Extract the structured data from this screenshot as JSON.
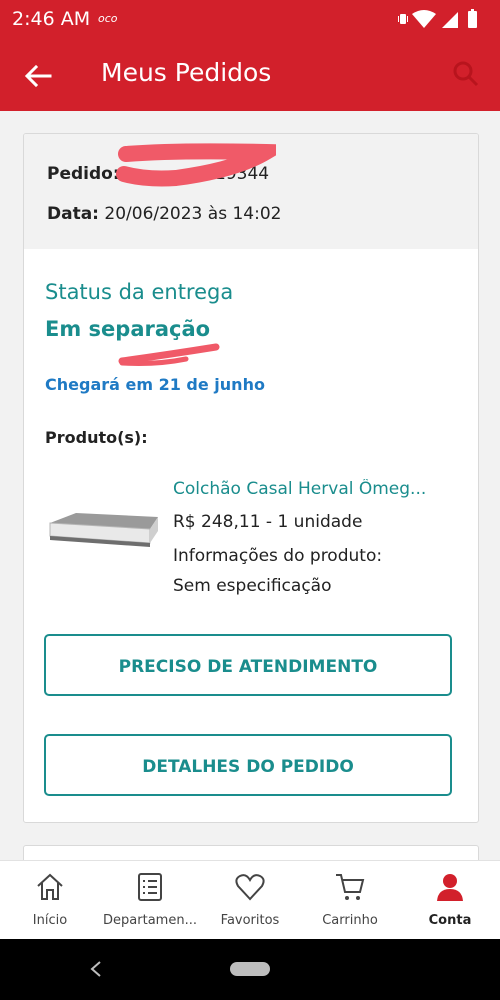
{
  "status_bar": {
    "time": "2:46 AM",
    "notification": "oco"
  },
  "header": {
    "title": "Meus Pedidos"
  },
  "order": {
    "order_label": "Pedido:",
    "order_number_visible": "19344",
    "date_label": "Data:",
    "date_value": "20/06/2023 às 14:02",
    "delivery_label": "Status da entrega",
    "delivery_status": "Em separação",
    "arrival": "Chegará em 21 de junho",
    "products_label": "Produto(s):",
    "product": {
      "name": "Colchão Casal Herval Ômeg...",
      "price_qty": "R$ 248,11 - 1 unidade",
      "info_label": "Informações do produto:",
      "spec": "Sem especificação"
    },
    "buttons": {
      "support": "PRECISO DE ATENDIMENTO",
      "details": "DETALHES DO PEDIDO"
    }
  },
  "bottom_nav": {
    "items": [
      {
        "label": "Início",
        "icon": "home-icon"
      },
      {
        "label": "Departamen...",
        "icon": "list-icon"
      },
      {
        "label": "Favoritos",
        "icon": "heart-icon"
      },
      {
        "label": "Carrinho",
        "icon": "cart-icon"
      },
      {
        "label": "Conta",
        "icon": "user-icon",
        "active": true
      }
    ]
  },
  "colors": {
    "brand_red": "#d2202b",
    "teal": "#1a8d8d",
    "link_blue": "#1f7ac4"
  }
}
